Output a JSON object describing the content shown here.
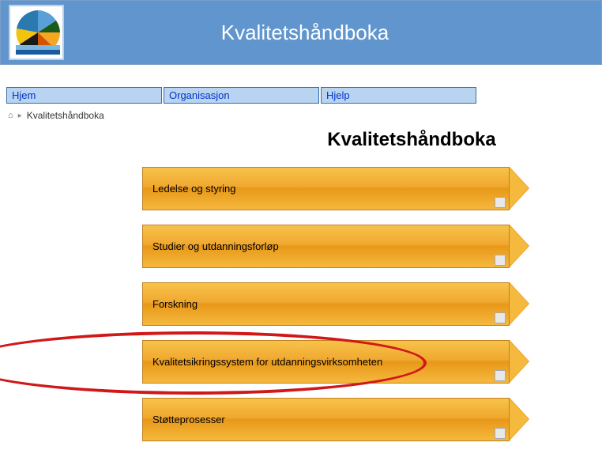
{
  "header": {
    "title": "Kvalitetshåndboka"
  },
  "nav": {
    "items": [
      {
        "label": "Hjem"
      },
      {
        "label": "Organisasjon"
      },
      {
        "label": "Hjelp"
      }
    ]
  },
  "breadcrumb": {
    "current": "Kvalitetshåndboka"
  },
  "page": {
    "title": "Kvalitetshåndboka"
  },
  "processes": [
    {
      "label": "Ledelse og styring"
    },
    {
      "label": "Studier og utdanningsforløp"
    },
    {
      "label": "Forskning"
    },
    {
      "label": "Kvalitetsikringssystem for utdanningsvirksomheten"
    },
    {
      "label": "Støtteprosesser"
    }
  ],
  "highlighted_index": 3,
  "colors": {
    "header_bg": "#6195cd",
    "nav_bg": "#b8d4f0",
    "arrow_gradient_top": "#f7c34a",
    "arrow_gradient_bottom": "#e89818",
    "highlight": "#d01818"
  }
}
